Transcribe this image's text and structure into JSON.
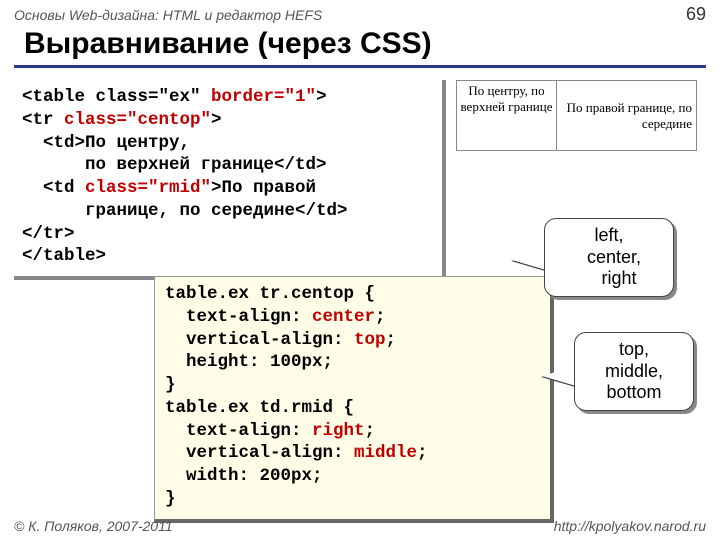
{
  "header": {
    "breadcrumb": "Основы Web-дизайна: HTML и редактор HEFS",
    "page_number": "69"
  },
  "title": "Выравнивание (через CSS)",
  "code_html": {
    "l1a": "<table class=\"ex\" ",
    "l1b": "border=\"1\"",
    "l1c": ">",
    "l2a": "<tr ",
    "l2b": "class=\"centop\"",
    "l2c": ">",
    "l3": "  <td>По центру,",
    "l4": "      по верхней границе</td>",
    "l5a": "  <td ",
    "l5b": "class=\"rmid\"",
    "l5c": ">По правой",
    "l6": "      границе, по середине</td>",
    "l7": "</tr>",
    "l8": "</table>"
  },
  "code_css": {
    "l1": "table.ex tr.centop {",
    "l2a": "  text-align: ",
    "l2b": "center",
    "l2c": ";",
    "l3a": "  vertical-align: ",
    "l3b": "top",
    "l3c": ";",
    "l4": "  height: 100px;",
    "l5": "}",
    "l6": "table.ex td.rmid {",
    "l7a": "  text-align: ",
    "l7b": "right",
    "l7c": ";",
    "l8a": "  vertical-align: ",
    "l8b": "middle",
    "l8c": ";",
    "l9": "  width: 200px;",
    "l10": "}"
  },
  "example": {
    "cell1": "По центру, по верхней границе",
    "cell2": "По правой границе, по середине"
  },
  "callouts": {
    "align_h": "left,\n  center,\n    right",
    "align_v": "top,\nmiddle,\nbottom"
  },
  "footer": {
    "copyright": "© К. Поляков, 2007-2011",
    "url": "http://kpolyakov.narod.ru"
  }
}
